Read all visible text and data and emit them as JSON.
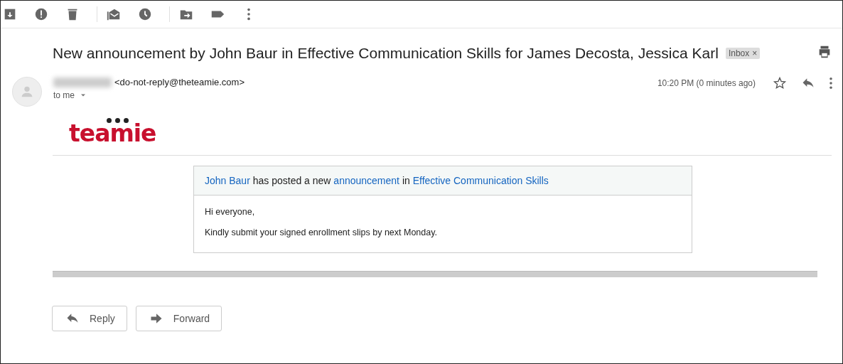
{
  "toolbar": [
    {
      "kind": "archive"
    },
    {
      "kind": "spam"
    },
    {
      "kind": "delete"
    },
    {
      "kind": "divider"
    },
    {
      "kind": "unread"
    },
    {
      "kind": "snooze"
    },
    {
      "kind": "divider"
    },
    {
      "kind": "move"
    },
    {
      "kind": "label"
    },
    {
      "kind": "more"
    }
  ],
  "subject": "New announcement by John Baur in Effective Communication Skills for James Decosta, Jessica Karl",
  "label_chip": {
    "text": "Inbox",
    "remove": "×"
  },
  "sender": {
    "email": "<do-not-reply@theteamie.com>",
    "recipient": "to me",
    "time": "10:20 PM (0 minutes ago)"
  },
  "logo": "teamie",
  "card": {
    "intro": [
      {
        "kind": "link",
        "text": "John Baur"
      },
      {
        "kind": "plain",
        "text": " has posted a new "
      },
      {
        "kind": "link",
        "text": "announcement"
      },
      {
        "kind": "plain",
        "text": " in "
      },
      {
        "kind": "link",
        "text": "Effective Communication Skills"
      }
    ],
    "paragraphs": [
      "Hi everyone,",
      "Kindly submit your signed enrollment slips by next Monday."
    ]
  },
  "actions": [
    {
      "kind": "reply",
      "label": "Reply"
    },
    {
      "kind": "forward",
      "label": "Forward"
    }
  ]
}
